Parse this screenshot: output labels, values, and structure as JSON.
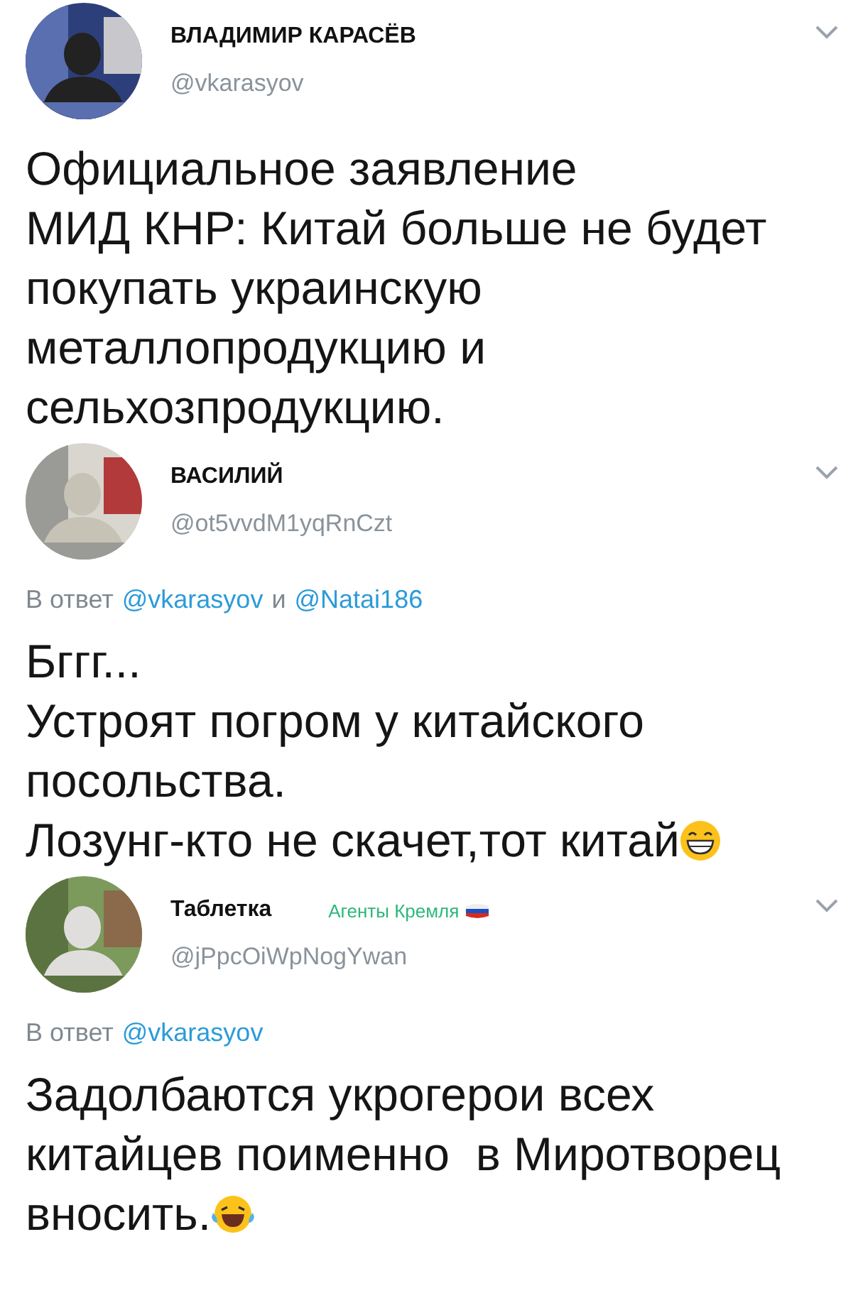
{
  "tweets": [
    {
      "name": "ВЛАДИМИР КАРАСЁВ",
      "handle": "@vkarasyov",
      "text": "Официальное заявление\nМИД КНР: Китай больше не будет покупать украинскую металлопродукцию и сельхозпродукцию."
    },
    {
      "name": "ВАСИЛИЙ",
      "handle": "@ot5vvdM1yqRnCzt",
      "reply_to": {
        "prefix": "В ответ",
        "mentions": [
          "@vkarasyov",
          "@Natai186"
        ],
        "joiner": "и"
      },
      "text": "Бггг...\nУстроят погром у китайского посольства.\nЛозунг-кто не скачет,тот китай",
      "end_emoji": {
        "kind": "grin"
      }
    },
    {
      "name": "Таблетка",
      "badge": "Агенты Кремля",
      "handle": "@jPpcOiWpNogYwan",
      "reply_to": {
        "prefix": "В ответ",
        "mentions": [
          "@vkarasyov"
        ]
      },
      "text": "Задолбаются укрогерои всех китайцев поименно  в Миротворец вносить.",
      "end_emoji": {
        "kind": "tears"
      }
    }
  ]
}
